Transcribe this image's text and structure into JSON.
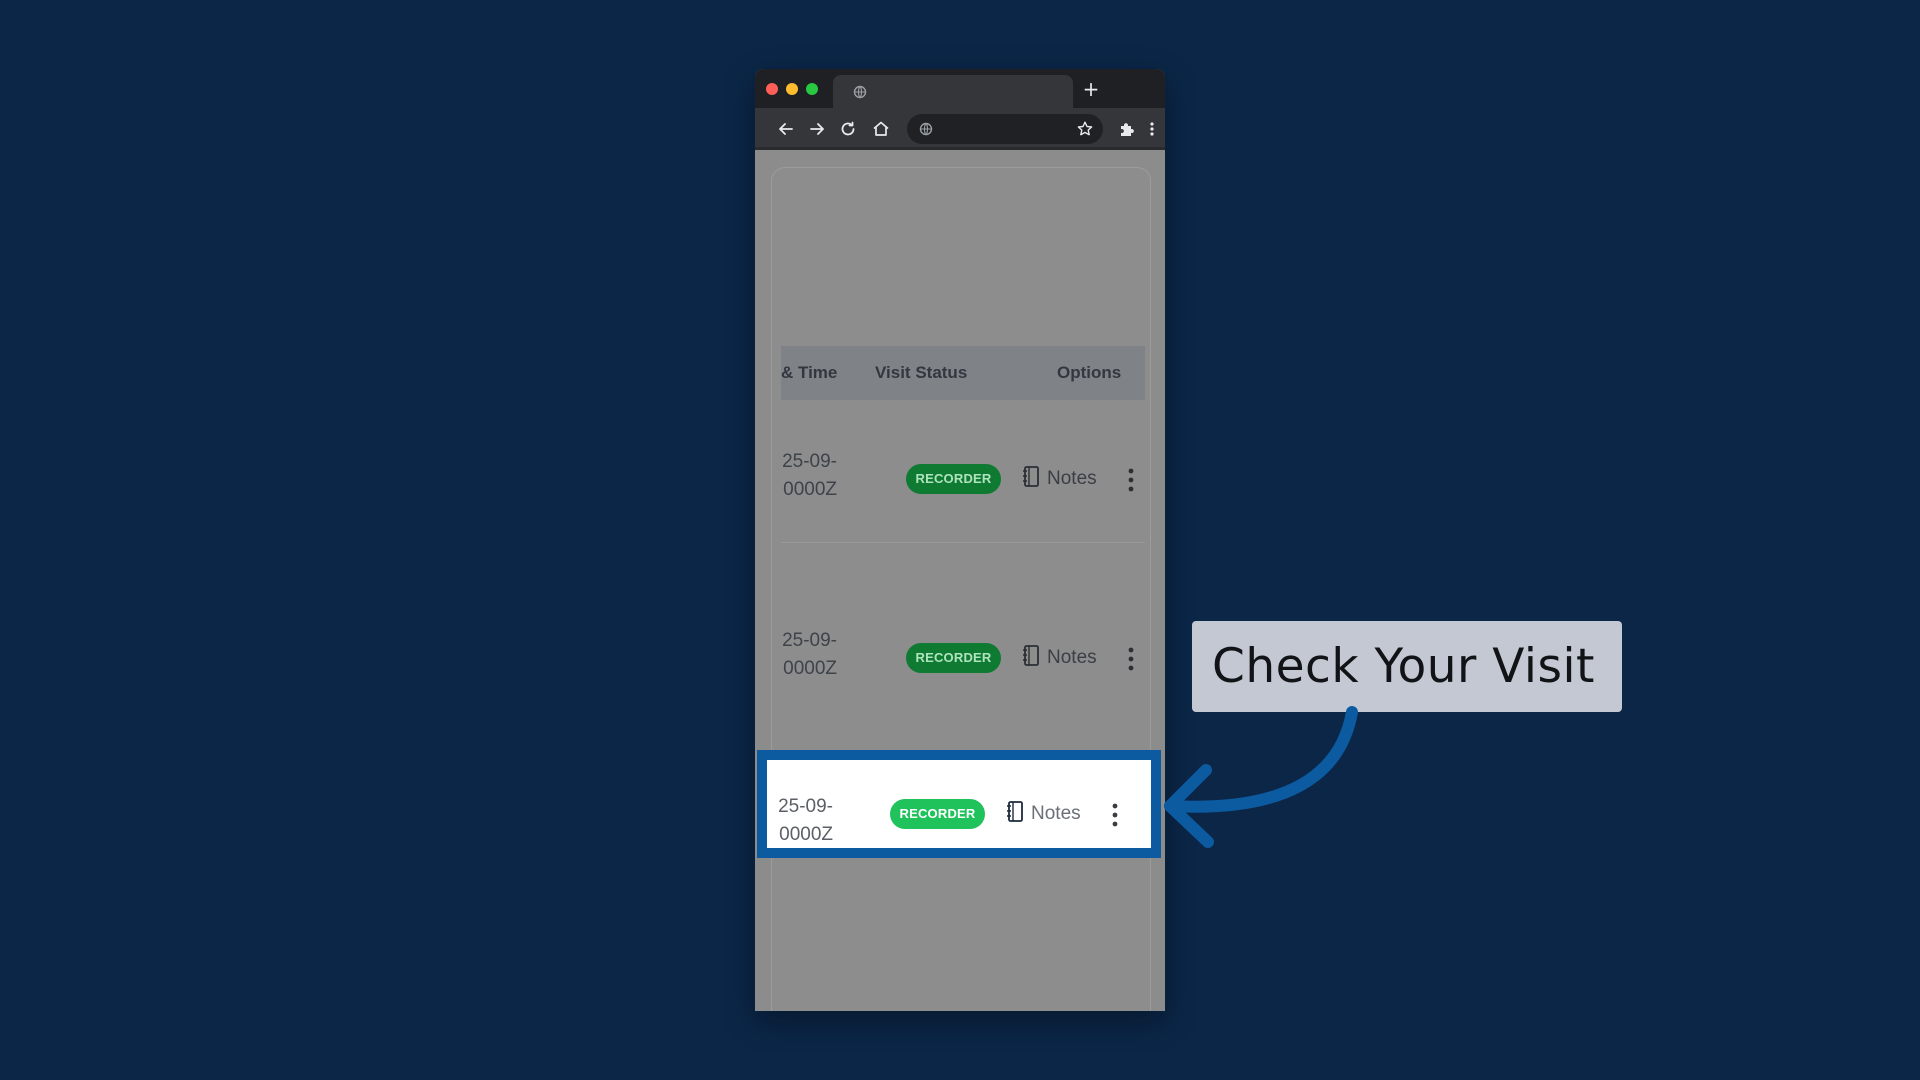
{
  "browser": {
    "new_tab_label": "+",
    "icons": {
      "tab": "globe-icon",
      "back": "back-arrow-icon",
      "forward": "forward-arrow-icon",
      "reload": "reload-icon",
      "home": "home-icon",
      "site": "globe-icon",
      "bookmark": "star-icon",
      "extensions": "puzzle-icon",
      "menu": "kebab-menu-icon"
    }
  },
  "table": {
    "headers": {
      "date_time": "& Time",
      "visit_status": "Visit Status",
      "options": "Options"
    },
    "rows": [
      {
        "date_line1": "25-09-",
        "date_line2": "0000Z",
        "status": "RECORDER",
        "notes_label": "Notes"
      },
      {
        "date_line1": "25-09-",
        "date_line2": "0000Z",
        "status": "RECORDER",
        "notes_label": "Notes"
      },
      {
        "date_line1": "25-09-",
        "date_line2": "0000Z",
        "status": "RECORDER",
        "notes_label": "Notes"
      }
    ]
  },
  "callout": {
    "text": "Check Your Visit"
  },
  "colors": {
    "background": "#0b2647",
    "highlight_border": "#0c5aa0",
    "badge_active": "#1fc25b",
    "callout_bg": "#c3c8d2"
  }
}
